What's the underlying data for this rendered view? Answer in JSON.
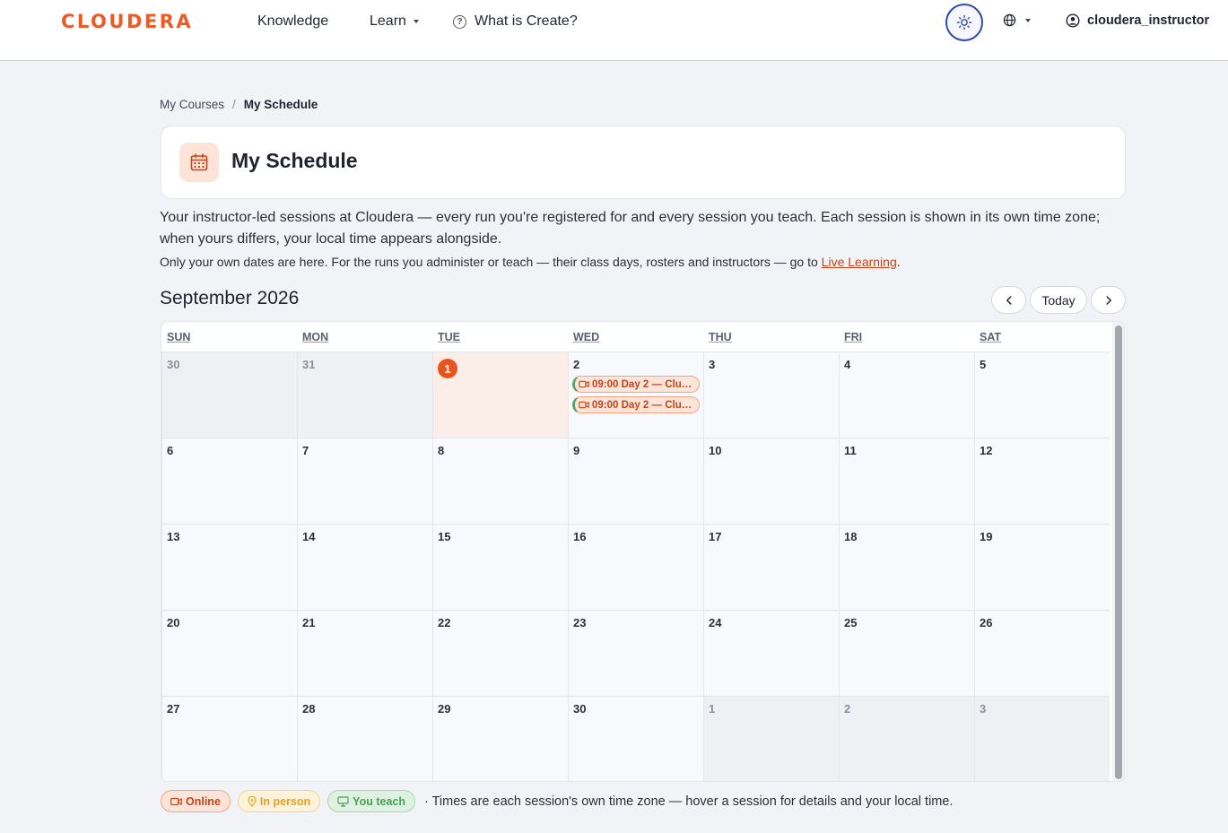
{
  "brand": {
    "logo_text": "CLOUDERA",
    "color": "#ec5b24"
  },
  "nav": {
    "knowledge": "Knowledge",
    "learn": "Learn",
    "what_is_create": "What is Create?",
    "username": "cloudera_instructor"
  },
  "breadcrumb": {
    "parent": "My Courses",
    "separator": "/",
    "current": "My Schedule"
  },
  "header": {
    "title": "My Schedule",
    "icon": "calendar-icon"
  },
  "intro": {
    "text": "Your instructor-led sessions at Cloudera — every run you're registered for and every session you teach. Each session is shown in its own time zone; when yours differs, your local time appears alongside.",
    "note_prefix": "Only your own dates are here. For the runs you administer or teach — their class days, rosters and instructors — go to ",
    "note_link": "Live Learning",
    "note_suffix": "."
  },
  "calendar": {
    "month_label": "September 2026",
    "today_button": "Today",
    "weekdays": [
      "SUN",
      "MON",
      "TUE",
      "WED",
      "THU",
      "FRI",
      "SAT"
    ],
    "days": [
      "30",
      "31",
      "1",
      "2",
      "3",
      "4",
      "5",
      "6",
      "7",
      "8",
      "9",
      "10",
      "11",
      "12",
      "13",
      "14",
      "15",
      "16",
      "17",
      "18",
      "19",
      "20",
      "21",
      "22",
      "23",
      "24",
      "25",
      "26",
      "27",
      "28",
      "29",
      "30",
      "1",
      "2",
      "3"
    ],
    "other_month_indices": [
      0,
      1,
      32,
      33,
      34
    ],
    "today_index": 2,
    "events": [
      {
        "day_index": 3,
        "slot": 0,
        "time": "09:00",
        "title": "Day 2 — Clu…",
        "type": "online"
      },
      {
        "day_index": 3,
        "slot": 1,
        "time": "09:00",
        "title": "Day 2 — Clu…",
        "type": "online"
      }
    ]
  },
  "legend": {
    "online": "Online",
    "in_person": "In person",
    "you_teach": "You teach",
    "note": "· Times are each session's own time zone — hover a session for details and your local time."
  },
  "colors": {
    "accent": "#e8541c",
    "online": "#c0461a",
    "in_person": "#e3a11f",
    "you_teach": "#48a052",
    "theme_ring": "#2c4eaa"
  }
}
